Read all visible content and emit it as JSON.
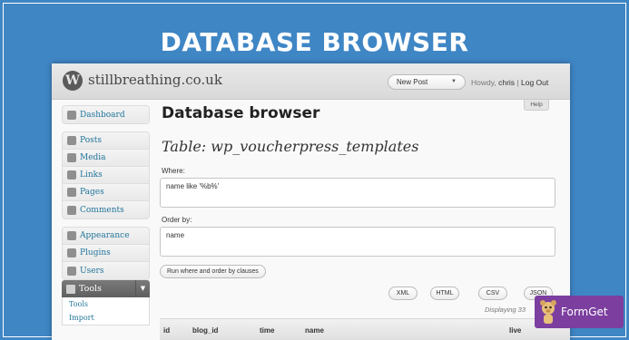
{
  "banner": {
    "title": "DATABASE BROWSER"
  },
  "header": {
    "site_name": "stillbreathing.co.uk",
    "new_post": "New Post",
    "howdy_prefix": "Howdy,",
    "username": "chris",
    "separator": "|",
    "logout": "Log Out",
    "help": "Help"
  },
  "sidebar": {
    "group1": [
      {
        "label": "Dashboard",
        "icon": "dashboard-icon"
      }
    ],
    "group2": [
      {
        "label": "Posts",
        "icon": "posts-icon"
      },
      {
        "label": "Media",
        "icon": "media-icon"
      },
      {
        "label": "Links",
        "icon": "links-icon"
      },
      {
        "label": "Pages",
        "icon": "pages-icon"
      },
      {
        "label": "Comments",
        "icon": "comments-icon"
      }
    ],
    "group3": [
      {
        "label": "Appearance",
        "icon": "appearance-icon"
      },
      {
        "label": "Plugins",
        "icon": "plugins-icon"
      },
      {
        "label": "Users",
        "icon": "users-icon"
      }
    ],
    "tools": {
      "label": "Tools",
      "items": [
        "Tools",
        "Import"
      ]
    }
  },
  "main": {
    "page_title": "Database browser",
    "table_title": "Table: wp_voucherpress_templates",
    "where_label": "Where:",
    "where_value": "name like '%b%'",
    "orderby_label": "Order by:",
    "orderby_value": "name",
    "run_button": "Run where and order by clauses",
    "formats": [
      "XML",
      "HTML",
      "CSV",
      "JSON"
    ],
    "displaying": "Displaying 33",
    "columns": [
      "id",
      "blog_id",
      "time",
      "name",
      "live"
    ]
  },
  "badge": {
    "text": "FormGet"
  },
  "colors": {
    "background": "#3f86c5",
    "link": "#21759b",
    "badge": "#7c3fa0"
  }
}
